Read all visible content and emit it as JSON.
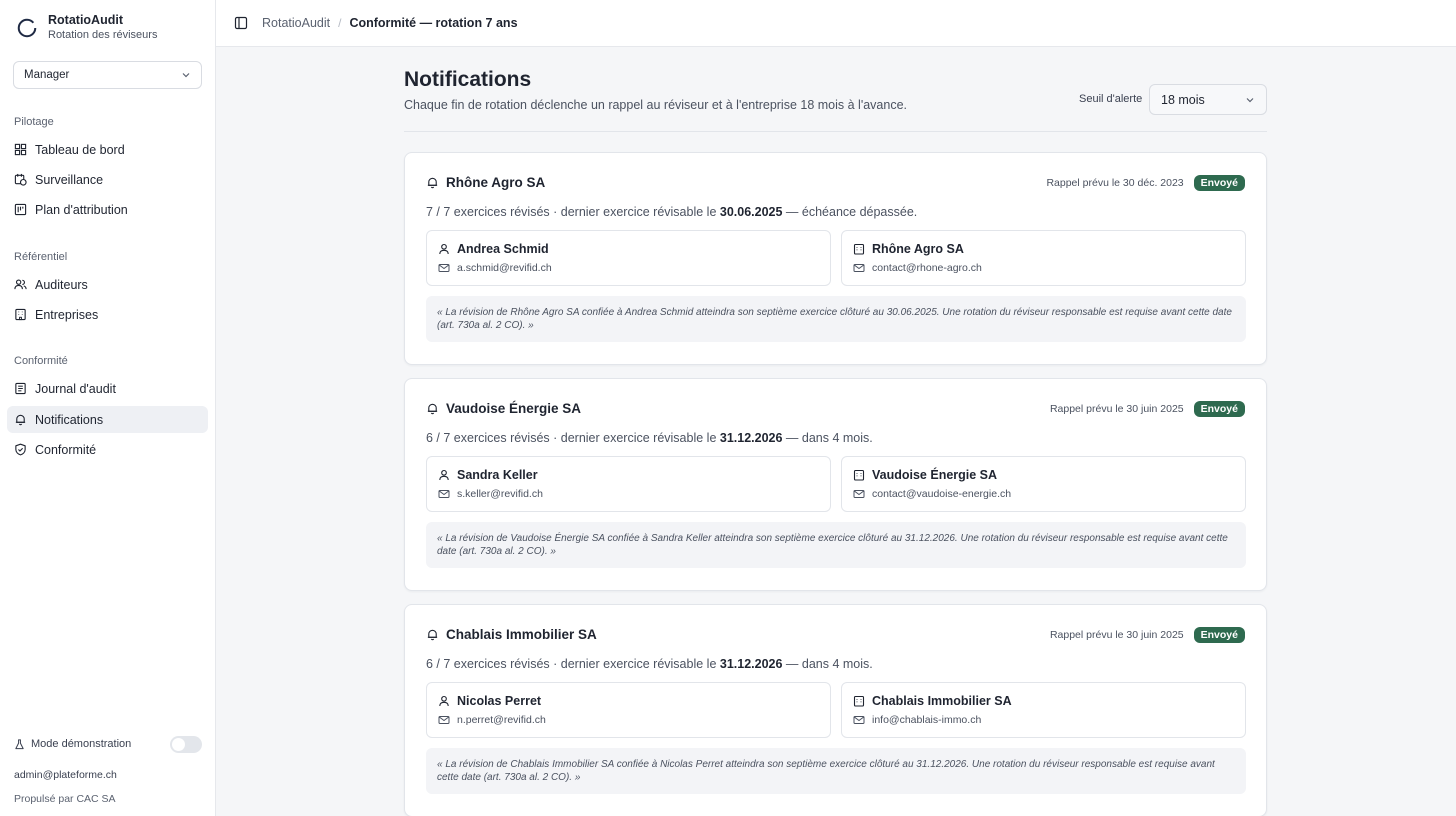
{
  "app": {
    "name": "RotatioAudit",
    "subtitle": "Rotation des réviseurs"
  },
  "role_select": {
    "value": "Manager"
  },
  "nav": {
    "groups": [
      {
        "title": "Pilotage",
        "items": [
          {
            "label": "Tableau de bord",
            "icon": "dashboard-icon"
          },
          {
            "label": "Surveillance",
            "icon": "clock-calendar-icon"
          },
          {
            "label": "Plan d'attribution",
            "icon": "plan-icon"
          }
        ]
      },
      {
        "title": "Référentiel",
        "items": [
          {
            "label": "Auditeurs",
            "icon": "users-icon"
          },
          {
            "label": "Entreprises",
            "icon": "building-icon"
          }
        ]
      },
      {
        "title": "Conformité",
        "items": [
          {
            "label": "Journal d'audit",
            "icon": "log-icon"
          },
          {
            "label": "Notifications",
            "icon": "bell-icon",
            "active": true
          },
          {
            "label": "Conformité",
            "icon": "shield-check-icon"
          }
        ]
      }
    ]
  },
  "sidebar_footer": {
    "demo_mode_label": "Mode démonstration",
    "demo_mode_on": false,
    "email": "admin@plateforme.ch",
    "powered_by": "Propulsé par CAC SA"
  },
  "breadcrumb": {
    "root": "RotatioAudit",
    "current": "Conformité — rotation 7 ans"
  },
  "page": {
    "title": "Notifications",
    "subtitle": "Chaque fin de rotation déclenche un rappel au réviseur et à l'entreprise 18 mois à l'avance.",
    "threshold_label": "Seuil d'alerte",
    "threshold_value": "18 mois"
  },
  "cards": [
    {
      "company": "Rhône Agro SA",
      "reminder": "Rappel prévu le 30 déc. 2023",
      "status": "Envoyé",
      "desc_prefix": "7 / 7 exercices révisés · dernier exercice révisable le ",
      "desc_date": "30.06.2025",
      "desc_suffix": " — échéance dépassée.",
      "auditor_name": "Andrea Schmid",
      "auditor_email": "a.schmid@revifid.ch",
      "company_contact": "Rhône Agro SA",
      "company_email": "contact@rhone-agro.ch",
      "message": "« La révision de Rhône Agro SA confiée à Andrea Schmid atteindra son septième exercice clôturé au 30.06.2025. Une rotation du réviseur responsable est requise avant cette date (art. 730a al. 2 CO). »"
    },
    {
      "company": "Vaudoise Énergie SA",
      "reminder": "Rappel prévu le 30 juin 2025",
      "status": "Envoyé",
      "desc_prefix": "6 / 7 exercices révisés · dernier exercice révisable le ",
      "desc_date": "31.12.2026",
      "desc_suffix": " — dans 4 mois.",
      "auditor_name": "Sandra Keller",
      "auditor_email": "s.keller@revifid.ch",
      "company_contact": "Vaudoise Énergie SA",
      "company_email": "contact@vaudoise-energie.ch",
      "message": "« La révision de Vaudoise Énergie SA confiée à Sandra Keller atteindra son septième exercice clôturé au 31.12.2026. Une rotation du réviseur responsable est requise avant cette date (art. 730a al. 2 CO). »"
    },
    {
      "company": "Chablais Immobilier SA",
      "reminder": "Rappel prévu le 30 juin 2025",
      "status": "Envoyé",
      "desc_prefix": "6 / 7 exercices révisés · dernier exercice révisable le ",
      "desc_date": "31.12.2026",
      "desc_suffix": " — dans 4 mois.",
      "auditor_name": "Nicolas Perret",
      "auditor_email": "n.perret@revifid.ch",
      "company_contact": "Chablais Immobilier SA",
      "company_email": "info@chablais-immo.ch",
      "message": "« La révision de Chablais Immobilier SA confiée à Nicolas Perret atteindra son septième exercice clôturé au 31.12.2026. Une rotation du réviseur responsable est requise avant cette date (art. 730a al. 2 CO). »"
    }
  ],
  "colors": {
    "status_badge": "#2e6a4f",
    "active_nav": "#eef0f4"
  }
}
